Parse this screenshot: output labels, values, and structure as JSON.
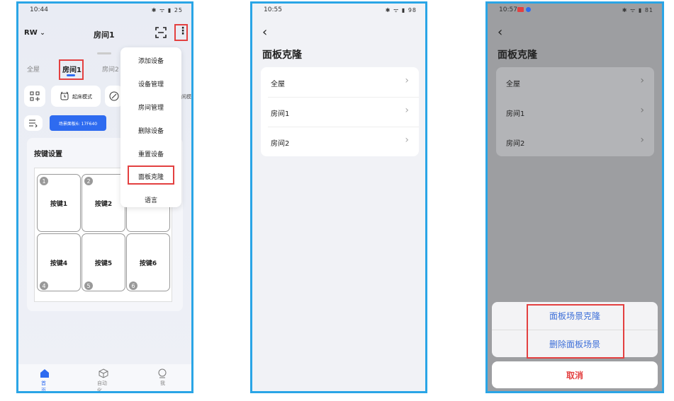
{
  "screen1": {
    "time": "10:44",
    "status_icons": "✱ ᯤ ▮ 25",
    "home_label": "RW",
    "title": "房间1",
    "tabs": [
      "全屋",
      "房间1",
      "房间2"
    ],
    "mode_chip": "起床模式",
    "mode_chip_right": "闲模",
    "scene_badge": "场景面板6: 17F640",
    "section_title": "按键设置",
    "keys": [
      "按键1",
      "按键2",
      "按键4",
      "按键5",
      "按键6"
    ],
    "key_numbers": [
      "1",
      "2",
      "4",
      "5",
      "6"
    ],
    "menu_items": [
      "添加设备",
      "设备管理",
      "房间管理",
      "删除设备",
      "重置设备",
      "面板克隆",
      "语言"
    ],
    "nav": [
      "首页",
      "自动化",
      "我"
    ],
    "accent_color": "#2e6bf0",
    "highlight_color": "#e34040"
  },
  "screen2": {
    "time": "10:55",
    "status_icons": "✱ ᯤ ▮ 98",
    "back_glyph": "‹",
    "title": "面板克隆",
    "rows": [
      "全屋",
      "房间1",
      "房间2"
    ]
  },
  "screen3": {
    "time": "10:57",
    "status_icons": "✱ ᯤ ▮ 81",
    "back_glyph": "‹",
    "title": "面板克隆",
    "rows": [
      "全屋",
      "房间1",
      "房间2"
    ],
    "sheet_actions": [
      "面板场景克隆",
      "删除面板场景"
    ],
    "cancel": "取消",
    "action_color": "#3d6fd8",
    "cancel_color": "#e34040"
  }
}
